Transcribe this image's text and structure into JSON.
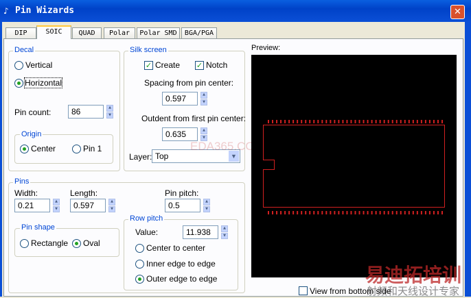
{
  "window": {
    "title": "Pin Wizards",
    "close": "✕",
    "icon": "♪"
  },
  "tabs": [
    {
      "label": "DIP"
    },
    {
      "label": "SOIC",
      "active": true
    },
    {
      "label": "QUAD"
    },
    {
      "label": "Polar"
    },
    {
      "label": "Polar SMD"
    },
    {
      "label": "BGA/PGA"
    }
  ],
  "decal": {
    "title": "Decal",
    "vertical": "Vertical",
    "horizontal": "Horizontal",
    "selected": "Horizontal",
    "pin_count_label": "Pin count:",
    "pin_count": "86"
  },
  "origin": {
    "title": "Origin",
    "center": "Center",
    "pin1": "Pin 1",
    "selected": "Center"
  },
  "silk": {
    "title": "Silk screen",
    "create": "Create",
    "create_checked": true,
    "notch": "Notch",
    "notch_checked": true,
    "spacing_label": "Spacing from pin center:",
    "spacing": "0.597",
    "outdent_label": "Outdent from first pin center:",
    "outdent": "0.635",
    "layer_label": "Layer:",
    "layer": "Top"
  },
  "pins": {
    "title": "Pins",
    "width_label": "Width:",
    "width": "0.21",
    "length_label": "Length:",
    "length": "0.597",
    "pitch_label": "Pin pitch:",
    "pitch": "0.5"
  },
  "pin_shape": {
    "title": "Pin shape",
    "rectangle": "Rectangle",
    "oval": "Oval",
    "selected": "Oval"
  },
  "row_pitch": {
    "title": "Row pitch",
    "value_label": "Value:",
    "value": "11.938",
    "opt1": "Center to center",
    "opt2": "Inner edge to edge",
    "opt3": "Outer edge to edge",
    "selected": "Outer edge to edge"
  },
  "preview": {
    "label": "Preview:",
    "pins_per_side": 43,
    "color": "#d22020",
    "bottom_label": "View from bottom side",
    "bottom_checked": false
  },
  "watermarks": {
    "eda": "EDA365.COM",
    "logo": "易迪拓培训",
    "logo_sub": "射频和天线设计专家"
  }
}
